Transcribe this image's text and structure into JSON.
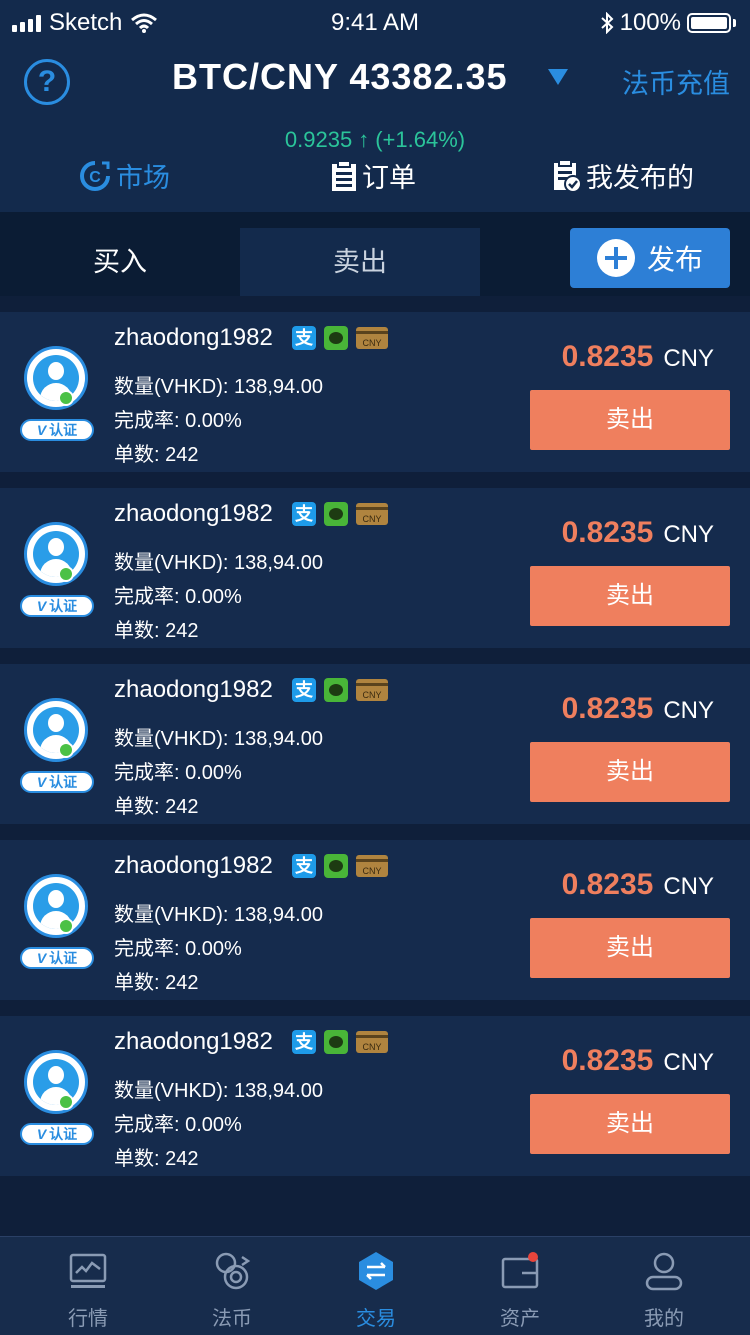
{
  "status_bar": {
    "carrier": "Sketch",
    "time": "9:41 AM",
    "battery": "100%"
  },
  "header": {
    "help_symbol": "?",
    "pair_title": "BTC/CNY 43382.35",
    "fiat_link": "法币充值",
    "change_value": "0.9235",
    "change_arrow": "↑",
    "change_percent": "(+1.64%)",
    "nav": [
      {
        "label": "市场",
        "icon": "market-icon",
        "active": true
      },
      {
        "label": "订单",
        "icon": "order-icon",
        "active": false
      },
      {
        "label": "我发布的",
        "icon": "my-posts-icon",
        "active": false
      }
    ]
  },
  "subtabs": {
    "buy": "买入",
    "sell": "卖出",
    "active": "sell",
    "publish": "发布"
  },
  "listings": [
    {
      "username": "zhaodong1982",
      "verify": "认证",
      "quantity": "数量(VHKD): 138,94.00",
      "rate": "完成率: 0.00%",
      "orders": "单数: 242",
      "price": "0.8235",
      "unit": "CNY",
      "action": "卖出",
      "card_label": "CNY"
    },
    {
      "username": "zhaodong1982",
      "verify": "认证",
      "quantity": "数量(VHKD): 138,94.00",
      "rate": "完成率: 0.00%",
      "orders": "单数: 242",
      "price": "0.8235",
      "unit": "CNY",
      "action": "卖出",
      "card_label": "CNY"
    },
    {
      "username": "zhaodong1982",
      "verify": "认证",
      "quantity": "数量(VHKD): 138,94.00",
      "rate": "完成率: 0.00%",
      "orders": "单数: 242",
      "price": "0.8235",
      "unit": "CNY",
      "action": "卖出",
      "card_label": "CNY"
    },
    {
      "username": "zhaodong1982",
      "verify": "认证",
      "quantity": "数量(VHKD): 138,94.00",
      "rate": "完成率: 0.00%",
      "orders": "单数: 242",
      "price": "0.8235",
      "unit": "CNY",
      "action": "卖出",
      "card_label": "CNY"
    },
    {
      "username": "zhaodong1982",
      "verify": "认证",
      "quantity": "数量(VHKD): 138,94.00",
      "rate": "完成率: 0.00%",
      "orders": "单数: 242",
      "price": "0.8235",
      "unit": "CNY",
      "action": "卖出",
      "card_label": "CNY"
    }
  ],
  "bottom_nav": [
    {
      "label": "行情",
      "icon": "chart-icon",
      "active": false
    },
    {
      "label": "法币",
      "icon": "currency-exchange-icon",
      "active": false
    },
    {
      "label": "交易",
      "icon": "trade-icon",
      "active": true
    },
    {
      "label": "资产",
      "icon": "wallet-icon",
      "active": false,
      "badge": true
    },
    {
      "label": "我的",
      "icon": "profile-icon",
      "active": false
    }
  ],
  "colors": {
    "accent": "#2a8de0",
    "sell": "#ef7f5e",
    "up": "#2bc49a",
    "background": "#0f1f3a"
  }
}
